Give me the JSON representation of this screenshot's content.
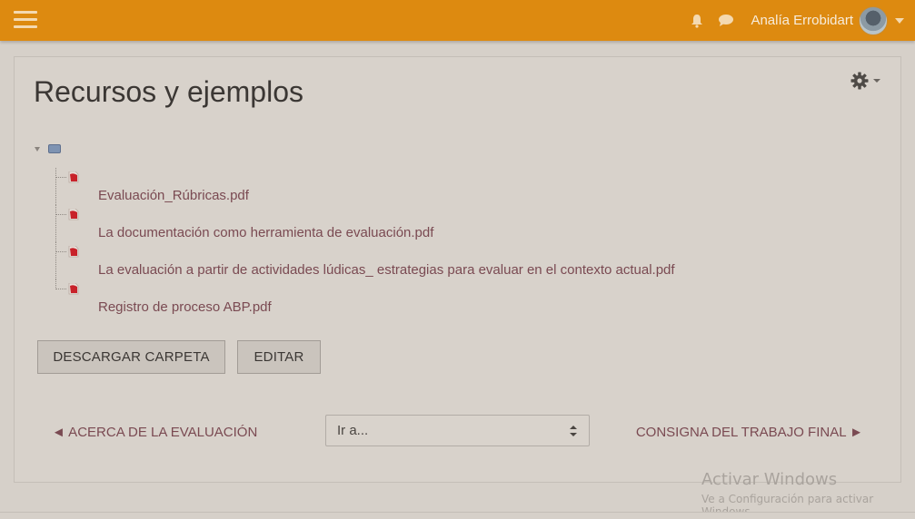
{
  "navbar": {
    "user_name": "Analía Errobidart",
    "colors": {
      "background": "#dd8a10"
    },
    "icons": [
      "hamburger-menu-icon",
      "bell-icon",
      "chat-bubble-icon",
      "avatar",
      "chevron-down-icon"
    ]
  },
  "page": {
    "title": "Recursos y ejemplos",
    "settings_icon": "gear-icon"
  },
  "folder": {
    "root_icon": "folder-icon",
    "files": [
      {
        "name": "Evaluación_Rúbricas.pdf",
        "icon": "pdf-icon"
      },
      {
        "name": "La documentación como herramienta de evaluación.pdf",
        "icon": "pdf-icon"
      },
      {
        "name": "La evaluación a partir de actividades lúdicas_ estrategias para evaluar en el contexto actual.pdf",
        "icon": "pdf-icon"
      },
      {
        "name": "Registro de proceso ABP.pdf",
        "icon": "pdf-icon"
      }
    ]
  },
  "buttons": {
    "download": "DESCARGAR CARPETA",
    "edit": "EDITAR"
  },
  "activity_nav": {
    "prev": "◄ ACERCA DE LA EVALUACIÓN",
    "jump_selected": "Ir a...",
    "next": "CONSIGNA DEL TRABAJO FINAL ►"
  },
  "watermark": {
    "title": "Activar Windows",
    "subtitle": "Ve a Configuración para activar",
    "subtitle2": "Windows."
  }
}
